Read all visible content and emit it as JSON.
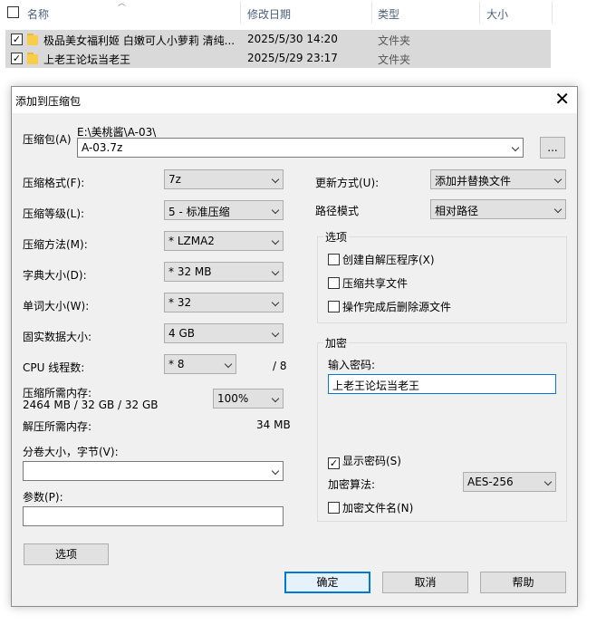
{
  "explorer": {
    "headers": {
      "name": "名称",
      "modified": "修改日期",
      "type": "类型",
      "size": "大小"
    },
    "rows": [
      {
        "name": "极品美女福利姬 白嫩可人小萝莉 清纯...",
        "modified": "2025/5/30 14:20",
        "type": "文件夹",
        "checked": "✓"
      },
      {
        "name": "上老王论坛当老王",
        "modified": "2025/5/29 23:17",
        "type": "文件夹",
        "checked": "✓"
      }
    ]
  },
  "dialog": {
    "title": "添加到压缩包",
    "close": "✕",
    "archive": {
      "label": "压缩包(A)",
      "path": "E:\\美桃酱\\A-03\\",
      "value": "A-03.7z",
      "browse": "..."
    },
    "left": [
      {
        "label": "压缩格式(F):",
        "value": "7z"
      },
      {
        "label": "压缩等级(L):",
        "value": "5 - 标准压缩"
      },
      {
        "label": "压缩方法(M):",
        "value": "*  LZMA2"
      },
      {
        "label": "字典大小(D):",
        "value": "*  32 MB"
      },
      {
        "label": "单词大小(W):",
        "value": "*  32"
      },
      {
        "label": "固实数据大小:",
        "value": "4 GB"
      }
    ],
    "cpu": {
      "label": "CPU 线程数:",
      "value": "*  8",
      "total": "/ 8"
    },
    "mem": {
      "label": "压缩所需内存:",
      "detail": "2464 MB / 32 GB / 32 GB",
      "value": "100%"
    },
    "decomp": {
      "label": "解压所需内存:",
      "value": "34 MB"
    },
    "split": {
      "label": "分卷大小，字节(V):",
      "value": ""
    },
    "params": {
      "label": "参数(P):",
      "value": ""
    },
    "options_button": "选项",
    "update": {
      "label": "更新方式(U):",
      "value": "添加并替换文件"
    },
    "pathmode": {
      "label": "路径模式",
      "value": "相对路径"
    },
    "options_group": {
      "title": "选项",
      "items": [
        {
          "label": "创建自解压程序(X)",
          "checked": ""
        },
        {
          "label": "压缩共享文件",
          "checked": ""
        },
        {
          "label": "操作完成后删除源文件",
          "checked": ""
        }
      ]
    },
    "encrypt_group": {
      "title": "加密",
      "password_label": "输入密码:",
      "password": "上老王论坛当老王",
      "show_password": {
        "label": "显示密码(S)",
        "checked": "✓"
      },
      "method_label": "加密算法:",
      "method": "AES-256",
      "encrypt_names": {
        "label": "加密文件名(N)",
        "checked": ""
      }
    },
    "buttons": {
      "ok": "确定",
      "cancel": "取消",
      "help": "帮助"
    }
  }
}
